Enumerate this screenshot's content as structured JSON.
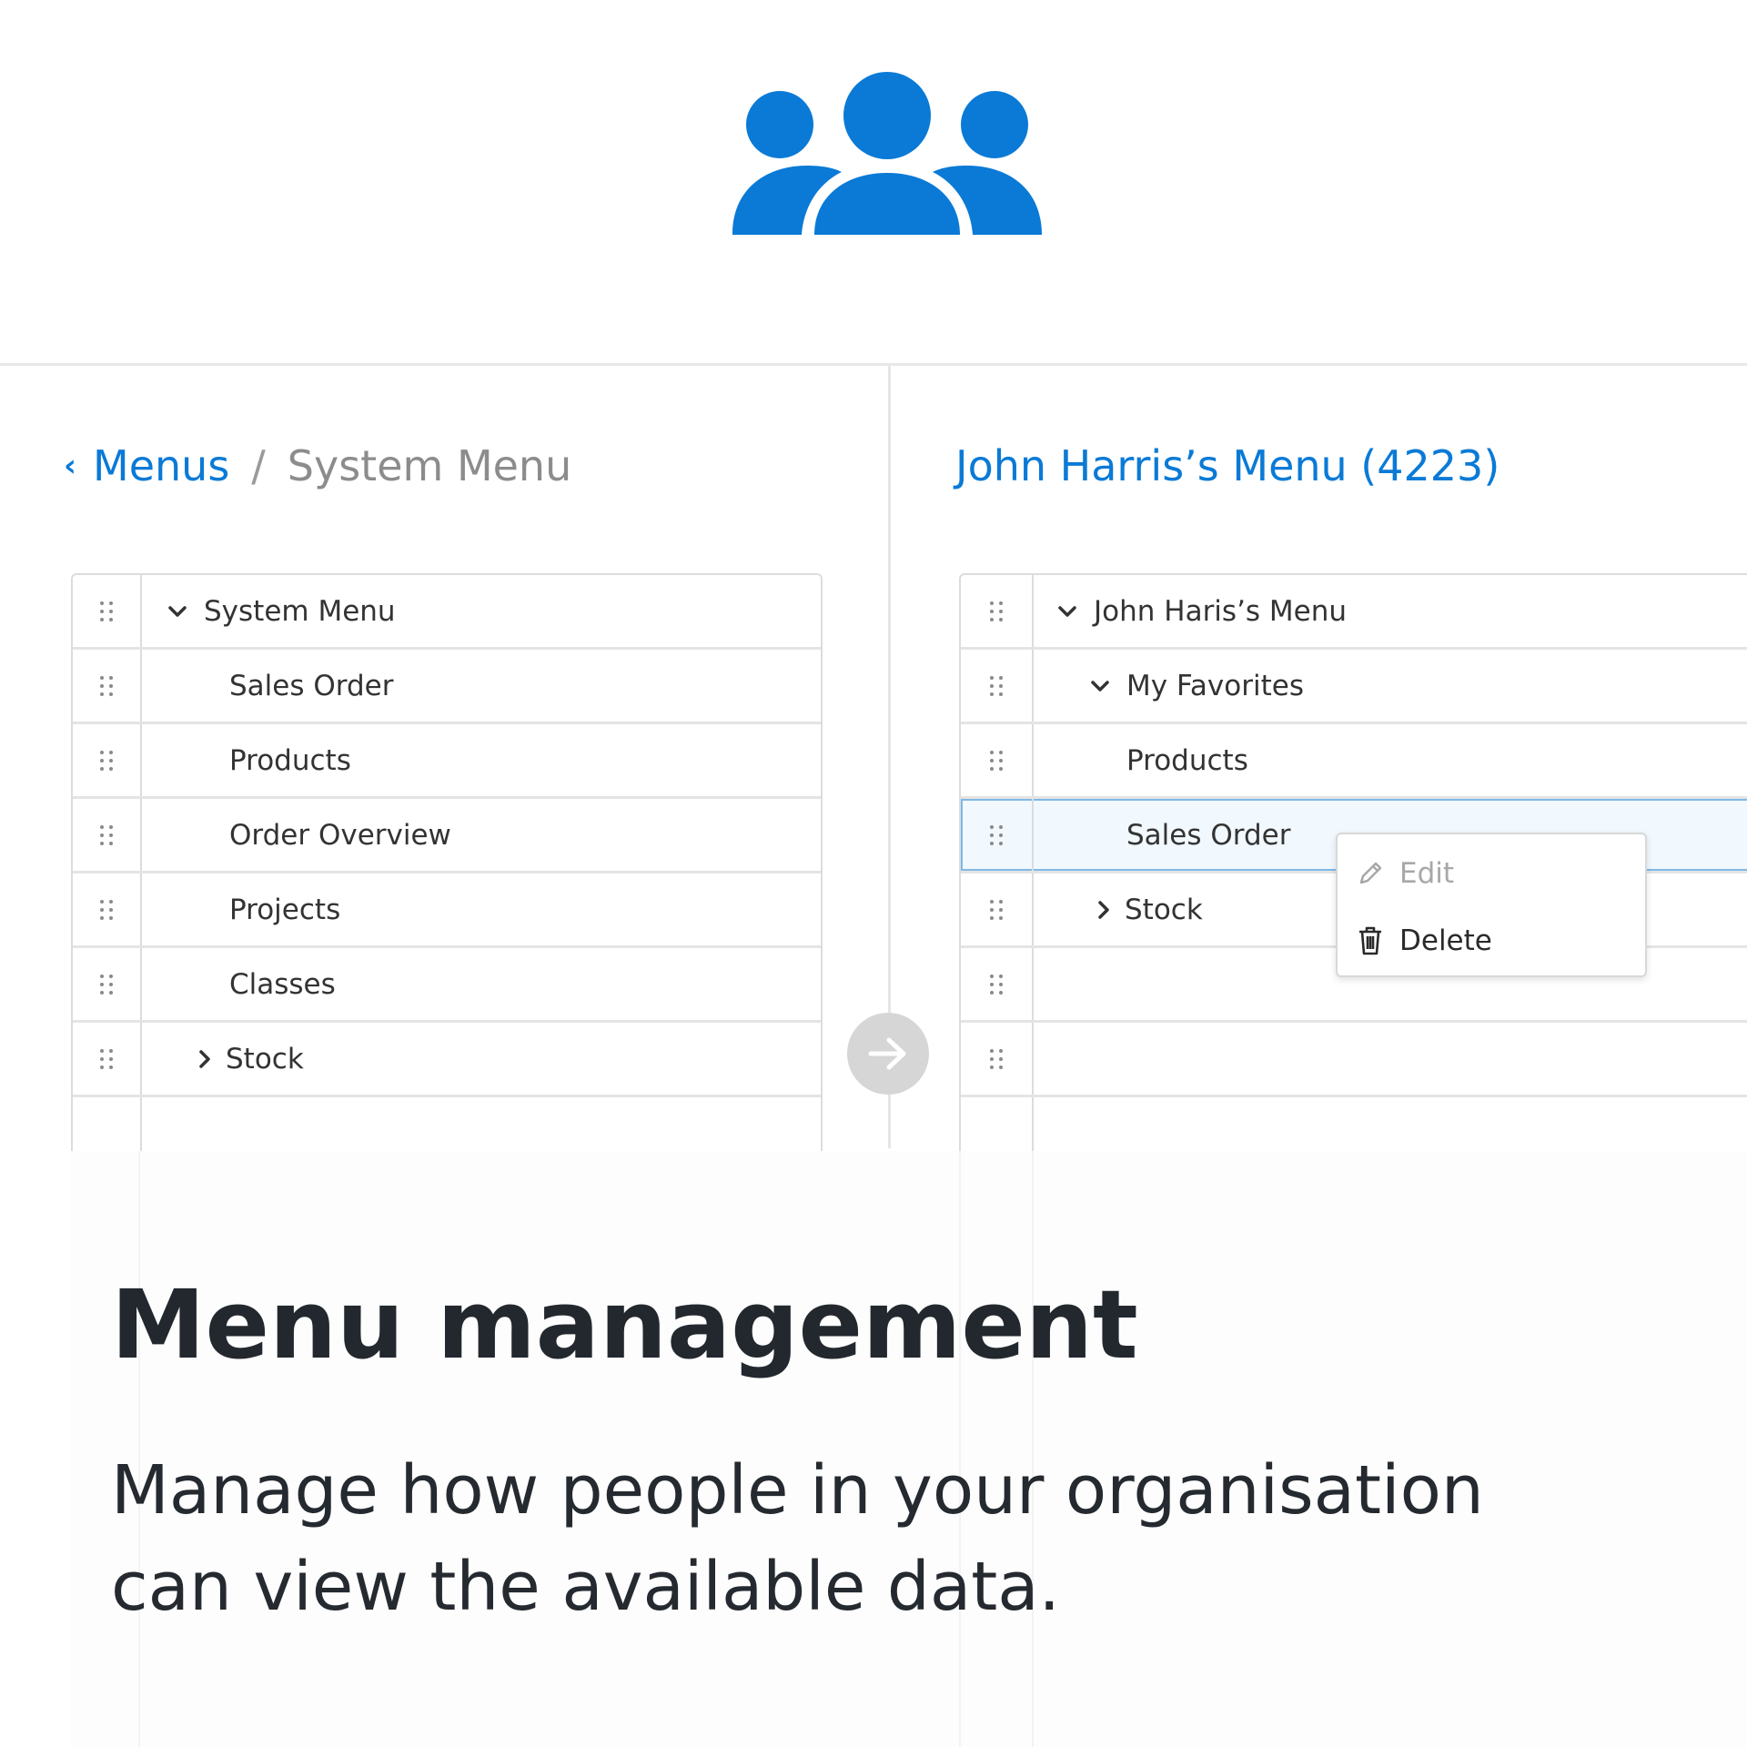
{
  "colors": {
    "accent": "#0a7ad6",
    "muted": "#8c8c8c",
    "text": "#333333",
    "headline": "#22282e",
    "selected_bg": "#f1f8fe",
    "selected_border": "#7fb8e6"
  },
  "hero": {
    "icon": "users-group-icon"
  },
  "breadcrumb": {
    "back_icon": "chevron-left-icon",
    "link": "Menus",
    "separator": "/",
    "current": "System Menu"
  },
  "right_panel": {
    "title": "John Harris’s Menu (4223)"
  },
  "left_tree": {
    "rows": [
      {
        "label": "System Menu",
        "chevron": "down"
      },
      {
        "label": "Sales Order"
      },
      {
        "label": "Products"
      },
      {
        "label": "Order Overview"
      },
      {
        "label": "Projects"
      },
      {
        "label": "Classes"
      },
      {
        "label": "Stock",
        "chevron": "right"
      }
    ]
  },
  "right_tree": {
    "rows": [
      {
        "label": "John Haris’s Menu",
        "chevron": "down"
      },
      {
        "label": "My Favorites",
        "chevron": "down"
      },
      {
        "label": "Products"
      },
      {
        "label": "Sales Order",
        "selected": true
      },
      {
        "label": "Stock",
        "chevron": "right"
      },
      {
        "label": ""
      },
      {
        "label": ""
      }
    ]
  },
  "transfer_button": {
    "icon": "arrow-right-icon"
  },
  "context_menu": {
    "edit_label": "Edit",
    "edit_icon": "pencil-icon",
    "delete_label": "Delete",
    "delete_icon": "trash-icon"
  },
  "feature": {
    "headline": "Menu management",
    "description": "Manage how people in your organisation can view the available data."
  }
}
